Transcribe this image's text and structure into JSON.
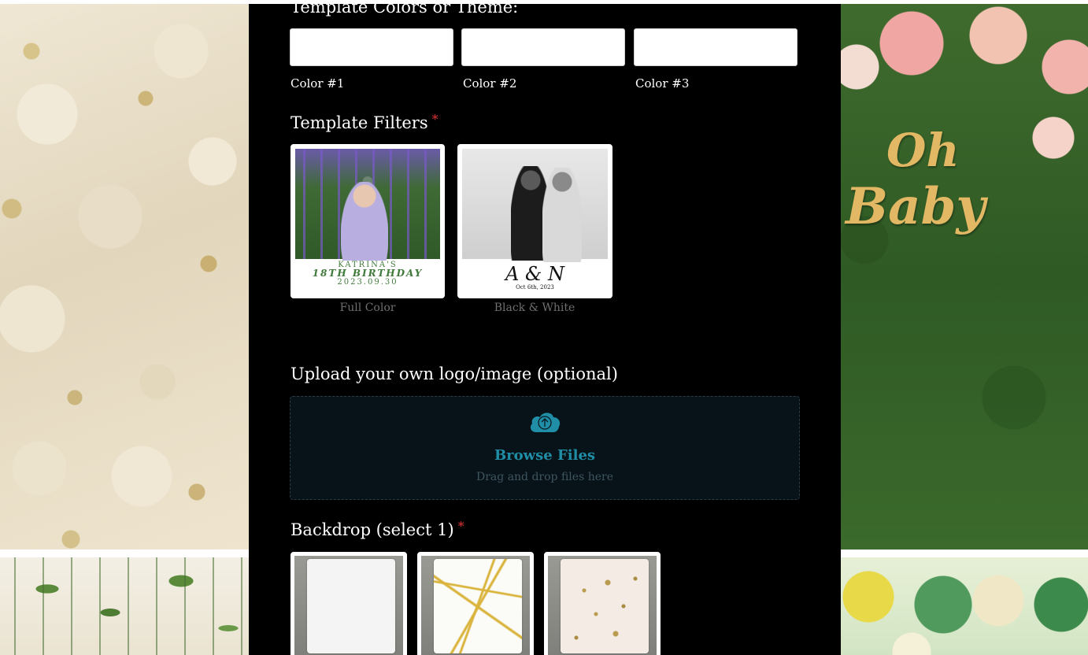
{
  "background": {
    "right_sign_line1": "Oh",
    "right_sign_line2": "Baby"
  },
  "colors_section": {
    "title": "Template Colors or Theme:",
    "inputs": [
      {
        "label": "Color #1",
        "value": ""
      },
      {
        "label": "Color #2",
        "value": ""
      },
      {
        "label": "Color #3",
        "value": ""
      }
    ]
  },
  "filters_section": {
    "title": "Template Filters",
    "required_mark": "*",
    "options": [
      {
        "label": "Full Color",
        "sample_text_line1": "KATRINA'S",
        "sample_text_line2": "18TH BIRTHDAY",
        "sample_text_line3": "2023.09.30"
      },
      {
        "label": "Black & White",
        "sample_monogram": "A & N",
        "sample_date": "Oct 6th, 2023"
      }
    ]
  },
  "upload_section": {
    "title": "Upload your own logo/image (optional)",
    "icon": "cloud-upload-icon",
    "browse_label": "Browse Files",
    "hint": "Drag and drop files here",
    "accent": "#1f8ea6"
  },
  "backdrop_section": {
    "title": "Backdrop (select 1)",
    "required_mark": "*",
    "options": [
      {
        "style": "white"
      },
      {
        "style": "gold-geometric"
      },
      {
        "style": "gold-flake"
      }
    ]
  }
}
